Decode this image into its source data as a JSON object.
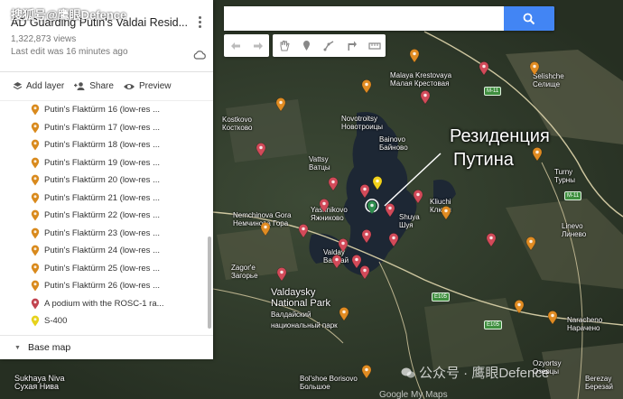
{
  "watermark_top": "搜狐号@鹰眼Defence",
  "watermark_bottom": "公众号 · 鹰眼Defence",
  "google_attr": "Google My Maps",
  "panel": {
    "title": "AD Guarding Putin's Valdai Resid...",
    "views": "1,322,873 views",
    "last_edit": "Last edit was 16 minutes ago",
    "actions": [
      {
        "label": "Add layer",
        "icon": "layers-icon"
      },
      {
        "label": "Share",
        "icon": "add-person-icon"
      },
      {
        "label": "Preview",
        "icon": "eye-icon"
      }
    ],
    "items": [
      {
        "label": "Putin's Flaktürm 16 (low-res ...",
        "marker": "orange"
      },
      {
        "label": "Putin's Flaktürm 17 (low-res ...",
        "marker": "orange"
      },
      {
        "label": "Putin's Flaktürm 18 (low-res ...",
        "marker": "orange"
      },
      {
        "label": "Putin's Flaktürm 19 (low-res ...",
        "marker": "orange"
      },
      {
        "label": "Putin's Flaktürm 20 (low-res ...",
        "marker": "orange"
      },
      {
        "label": "Putin's Flaktürm 21 (low-res ...",
        "marker": "orange"
      },
      {
        "label": "Putin's Flaktürm 22 (low-res ...",
        "marker": "orange"
      },
      {
        "label": "Putin's Flaktürm 23 (low-res ...",
        "marker": "orange"
      },
      {
        "label": "Putin's Flaktürm 24 (low-res ...",
        "marker": "orange"
      },
      {
        "label": "Putin's Flaktürm 25 (low-res ...",
        "marker": "orange"
      },
      {
        "label": "Putin's Flaktürm 26 (low-res ...",
        "marker": "orange"
      },
      {
        "label": "A podium with the ROSC-1 ra...",
        "marker": "red"
      },
      {
        "label": "S-400",
        "marker": "yellow"
      }
    ],
    "base_map": "Base map"
  },
  "search": {
    "placeholder": "",
    "value": ""
  },
  "map": {
    "caption_line1": "Резиденция",
    "caption_line2": "Путина",
    "places": [
      {
        "en": "Malaya Krestovaya",
        "ru": "Малая Крестовая"
      },
      {
        "en": "Kostkovo",
        "ru": "Костково"
      },
      {
        "en": "Novotroitsy",
        "ru": "Новотроицы"
      },
      {
        "en": "Bainovo",
        "ru": "Байново"
      },
      {
        "en": "Vattsy",
        "ru": "Ватцы"
      },
      {
        "en": "Kliuchi",
        "ru": "Ключи"
      },
      {
        "en": "Shuya",
        "ru": "Шуя"
      },
      {
        "en": "Nemchinova Gora",
        "ru": "Немчинова Гора"
      },
      {
        "en": "Yashnikovo",
        "ru": "Яжниково"
      },
      {
        "en": "Valday",
        "ru": "Валдай"
      },
      {
        "en": "Zagor'e",
        "ru": "Загорье"
      },
      {
        "en": "Valdaysky National Park",
        "ru": "Валдайский национальный парк"
      },
      {
        "en": "Selishche",
        "ru": "Селище"
      },
      {
        "en": "Turny",
        "ru": "Турны"
      },
      {
        "en": "Linevo",
        "ru": "Линево"
      },
      {
        "en": "Naracheno",
        "ru": "Нарачено"
      },
      {
        "en": "Ozyortsy",
        "ru": "Озерцы"
      },
      {
        "en": "Sukhaya Niva",
        "ru": "Сухая Нива"
      },
      {
        "en": "Bol'shoe Borisovo",
        "ru": "Большое"
      },
      {
        "en": "Berezay",
        "ru": "Березай"
      }
    ],
    "roads": [
      "M-11",
      "M-11",
      "E105",
      "E105"
    ]
  }
}
